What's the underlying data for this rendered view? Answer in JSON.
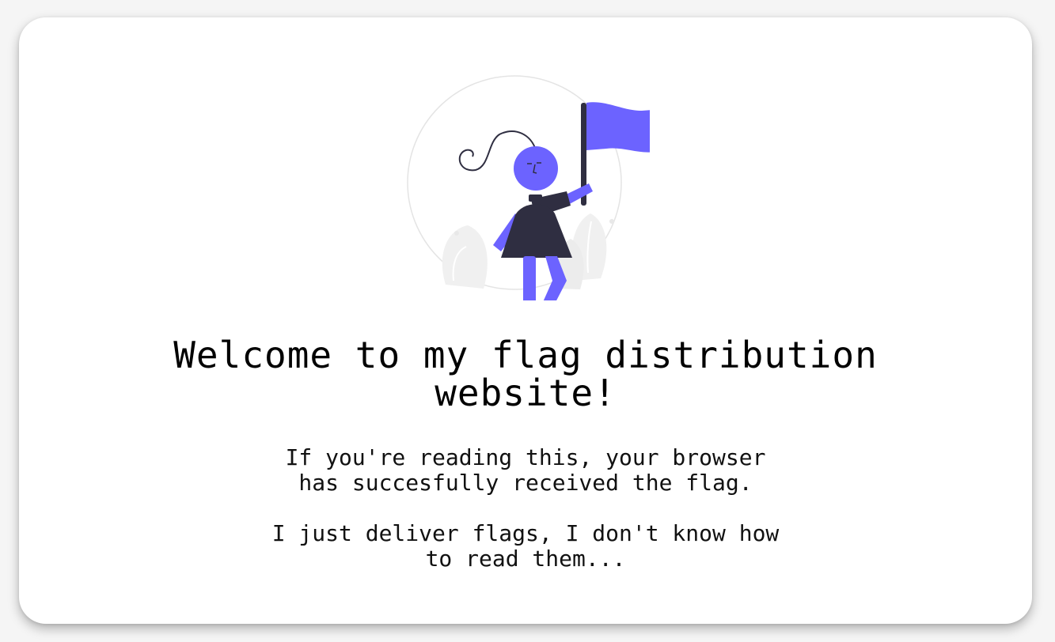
{
  "heading": {
    "line1": "Welcome to my flag distribution",
    "line2": "website!"
  },
  "message1": {
    "line1": "If you're reading this, your browser",
    "line2": "has succesfully received the flag."
  },
  "message2": {
    "line1": "I just deliver flags, I don't know how",
    "line2": "to read them..."
  },
  "colors": {
    "accent": "#6c63ff",
    "dark": "#2f2e41",
    "card": "#ffffff"
  },
  "illustration": {
    "icon": "woman-holding-flag-icon"
  }
}
